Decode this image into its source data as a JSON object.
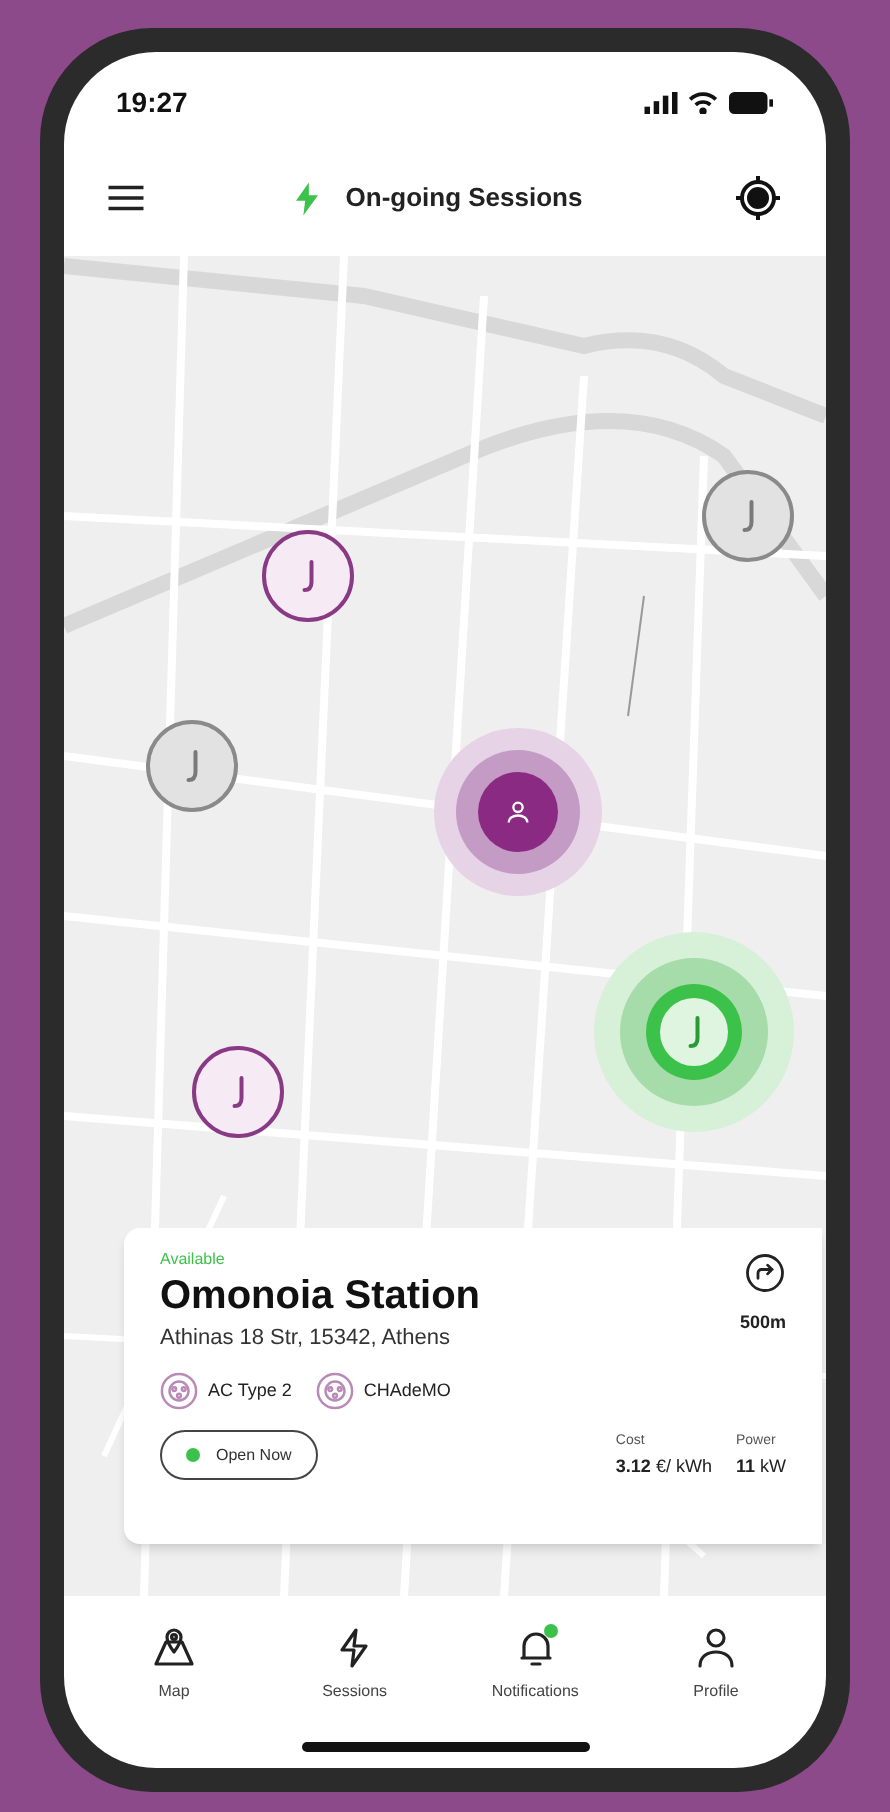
{
  "status_bar": {
    "time": "19:27"
  },
  "header": {
    "title": "On-going Sessions"
  },
  "map": {
    "markers": [
      {
        "kind": "station",
        "available": true,
        "selected": false
      },
      {
        "kind": "station",
        "available": false,
        "selected": false
      },
      {
        "kind": "station",
        "available": false,
        "selected": false
      },
      {
        "kind": "user"
      },
      {
        "kind": "station",
        "available": true,
        "selected": true
      },
      {
        "kind": "station",
        "available": true,
        "selected": false
      }
    ]
  },
  "station_card": {
    "availability": "Available",
    "name": "Omonoia Station",
    "address": "Athinas 18 Str, 15342, Athens",
    "distance": "500m",
    "connectors": [
      {
        "label": "AC Type 2"
      },
      {
        "label": "CHAdeMO"
      }
    ],
    "open_status": {
      "label": "Open Now",
      "open": true
    },
    "cost": {
      "label": "Cost",
      "value": "3.12",
      "unit": "€/ kWh"
    },
    "power": {
      "label": "Power",
      "value": "11",
      "unit": "kW"
    }
  },
  "bottom_nav": [
    {
      "label": "Map",
      "badge": false
    },
    {
      "label": "Sessions",
      "badge": false
    },
    {
      "label": "Notifications",
      "badge": true
    },
    {
      "label": "Profile",
      "badge": false
    }
  ]
}
